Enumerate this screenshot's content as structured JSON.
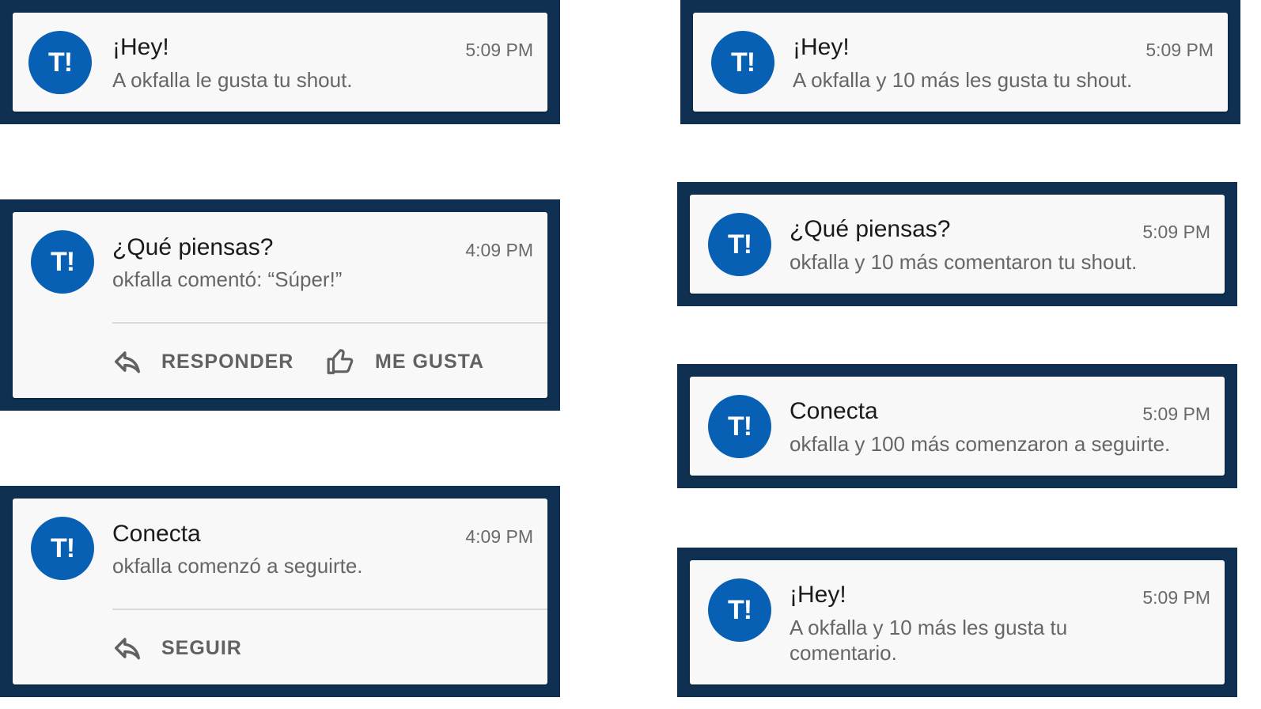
{
  "avatar": {
    "text": "T!",
    "bg": "#0760b4"
  },
  "colors": {
    "frame": "#0f3050",
    "card": "#f8f8f8"
  },
  "notifications": [
    {
      "title": "¡Hey!",
      "time": "5:09 PM",
      "body": "A okfalla le gusta tu shout."
    },
    {
      "title": "¿Qué piensas?",
      "time": "4:09 PM",
      "body": "okfalla comentó:  “Súper!”",
      "actions": [
        {
          "label": "RESPONDER",
          "icon": "reply-icon"
        },
        {
          "label": "ME GUSTA",
          "icon": "thumbs-up-icon"
        }
      ]
    },
    {
      "title": "Conecta",
      "time": "4:09 PM",
      "body": "okfalla comenzó a seguirte.",
      "actions": [
        {
          "label": "SEGUIR",
          "icon": "reply-icon"
        }
      ]
    },
    {
      "title": "¡Hey!",
      "time": "5:09 PM",
      "body": "A okfalla y 10 más les gusta tu shout."
    },
    {
      "title": "¿Qué piensas?",
      "time": "5:09 PM",
      "body": "okfalla y 10 más comentaron tu shout."
    },
    {
      "title": "Conecta",
      "time": "5:09 PM",
      "body": "okfalla y 100 más comenzaron a seguirte."
    },
    {
      "title": "¡Hey!",
      "time": "5:09 PM",
      "body": "A okfalla y 10 más les gusta tu comentario."
    }
  ]
}
